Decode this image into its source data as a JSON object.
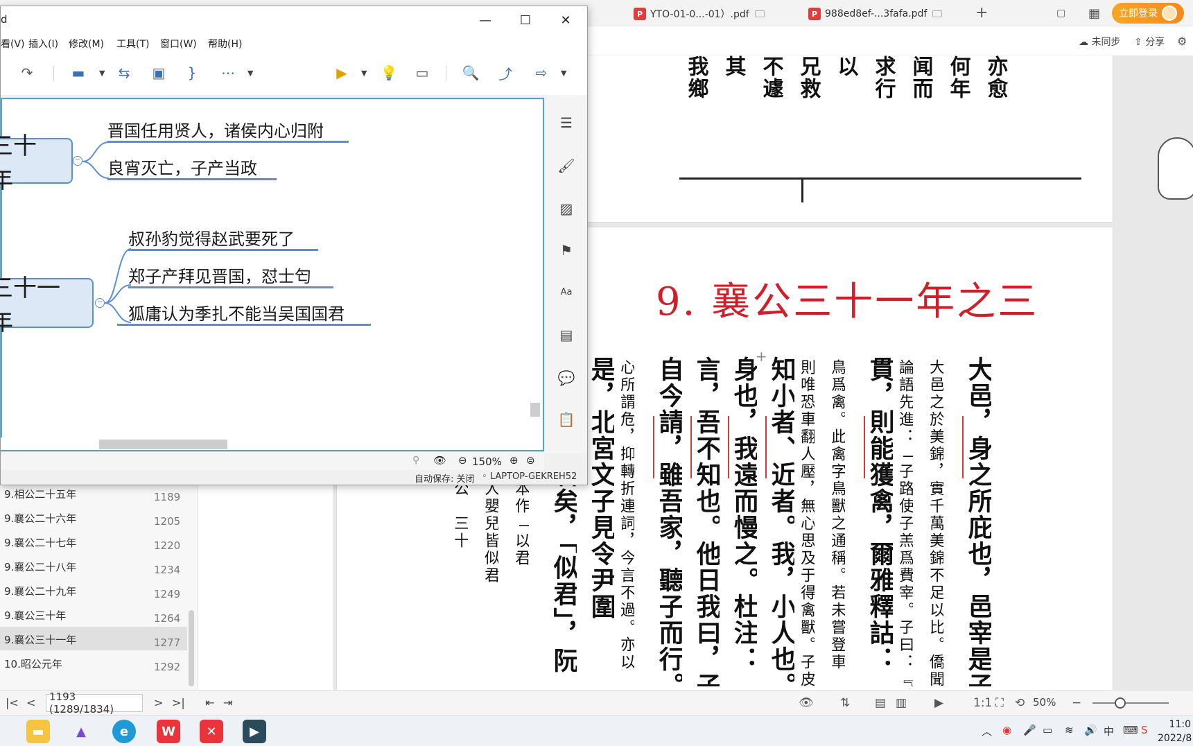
{
  "pdf_viewer": {
    "tabs": [
      {
        "label": "YTO-01-0...-01）.pdf"
      },
      {
        "label": "988ed8ef-...3fafa.pdf"
      }
    ],
    "login_label": "立即登录",
    "sync_label": "未同步",
    "share_label": "分享",
    "page_title": "9. 襄公三十一年之三",
    "page_input": "1193 (1289/1834)",
    "zoom": "50%",
    "top_page_columns": [
      "亦愈",
      "何年",
      "闻而",
      "求行",
      "以",
      "兄救",
      "不遽",
      "其",
      "我鄉"
    ],
    "main_columns": [
      {
        "text": "大邑，身之所庇也，邑宰是子皮氏之大官",
        "style": "big"
      },
      {
        "text": "大邑之於美錦，實千萬美錦不足以比。僑聞",
        "style": "small"
      },
      {
        "text": "論語先進：「子路使子羔爲費宰。子曰：『賊夫人",
        "style": "small"
      },
      {
        "text": "貫，則能獲禽，爾雅釋詁：「貫，習也。」今作",
        "style": "big"
      },
      {
        "text": "鳥爲禽。此禽字鳥獸之通稱。若未嘗登車",
        "style": "small"
      },
      {
        "text": "則唯恐車翻人壓，無心思及于得禽獸。子皮",
        "style": "small"
      },
      {
        "text": "知小者、近者。我，小人也。衣服附",
        "style": "big"
      },
      {
        "text": "身也，我遠而慢之。杜注：「慢，易也。」",
        "style": "big"
      },
      {
        "text": "言，吾不知也。他日我曰，子爲鄭國",
        "style": "big"
      },
      {
        "text": "自今請，雖吾家，聽子而行。」子産曰",
        "style": "big"
      },
      {
        "text": "心所謂危，抑轉折連詞，今言不過。亦以",
        "style": "small"
      },
      {
        "text": "是，北宮文子見令尹圍",
        "style": "big"
      },
      {
        "text": "「令尹似君矣，「似君」，阮",
        "style": "big"
      },
      {
        "text": "然孔疏又引服虔本作「以君",
        "style": "small"
      },
      {
        "text": "祖本紀「鄉者夫人嬰兒皆似君",
        "style": "small"
      },
      {
        "text": "秋左傳注　襄　公　三十",
        "style": "small"
      }
    ],
    "outline": [
      {
        "title": "9.相公二十五年",
        "page": "1189"
      },
      {
        "title": "9.襄公二十六年",
        "page": "1205"
      },
      {
        "title": "9.襄公二十七年",
        "page": "1220"
      },
      {
        "title": "9.襄公二十八年",
        "page": "1234"
      },
      {
        "title": "9.襄公二十九年",
        "page": "1249"
      },
      {
        "title": "9.襄公三十年",
        "page": "1264"
      },
      {
        "title": "9.襄公三十一年",
        "page": "1277"
      },
      {
        "title": "10.昭公元年",
        "page": "1292"
      }
    ]
  },
  "mindmap": {
    "title": "d",
    "menu": [
      "看(V)",
      "插入(I)",
      "修改(M)",
      "工具(T)",
      "窗口(W)",
      "帮助(H)"
    ],
    "nodes": [
      {
        "label": "三十年",
        "children": [
          "晋国任用贤人，诸侯内心归附",
          "良宵灭亡，子产当政"
        ]
      },
      {
        "label": "三十一年",
        "children": [
          "叔孙豹觉得赵武要死了",
          "郑子产拜见晋国，怼士匄",
          "狐庸认为季扎不能当吴国国君"
        ]
      }
    ],
    "zoom": "150%",
    "autosave": "自动保存: 关闭",
    "computer": "LAPTOP-GEKREH52"
  },
  "taskbar": {
    "time": "11:0",
    "date": "2022/8"
  },
  "colors": {
    "title_red": "#d01f2a",
    "node_border": "#5c8ed6",
    "node_fill": "#dde8f6",
    "canvas_border": "#4aa8c8",
    "login_orange": "#f6a623"
  }
}
